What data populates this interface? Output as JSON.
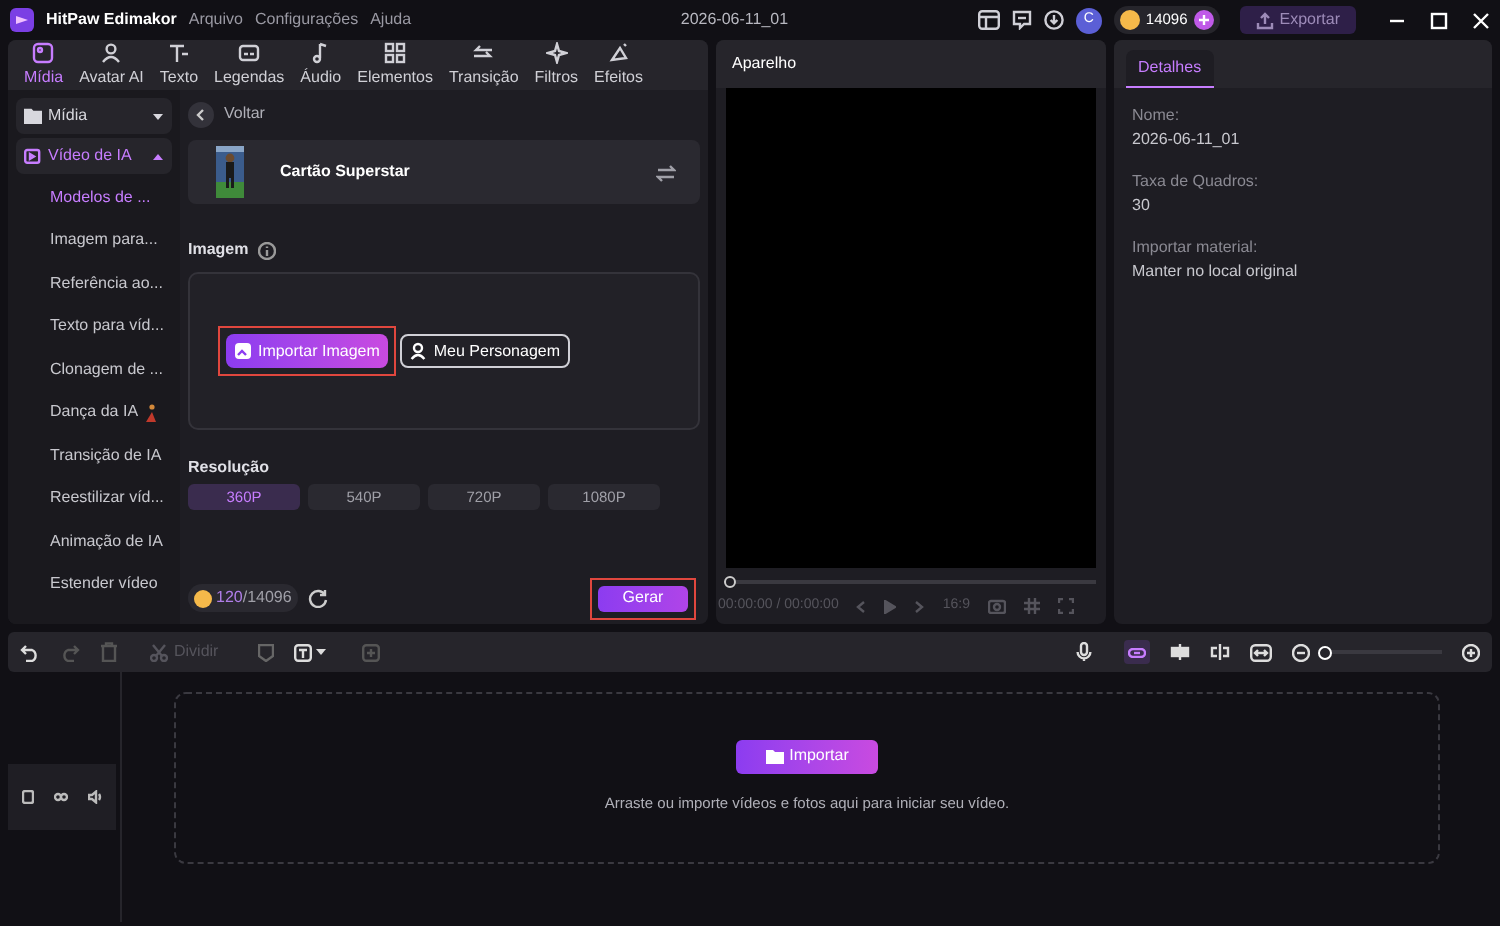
{
  "titlebar": {
    "app_name": "HitPaw Edimakor",
    "menu": [
      "Arquivo",
      "Configurações",
      "Ajuda"
    ],
    "project_title": "2026-06-11_01",
    "avatar_letter": "C",
    "credits": "14096",
    "export": "Exportar"
  },
  "toolbar_tabs": [
    {
      "label": "Mídia",
      "selected": true
    },
    {
      "label": "Avatar AI",
      "selected": false
    },
    {
      "label": "Texto",
      "selected": false
    },
    {
      "label": "Legendas",
      "selected": false
    },
    {
      "label": "Áudio",
      "selected": false
    },
    {
      "label": "Elementos",
      "selected": false
    },
    {
      "label": "Transição",
      "selected": false
    },
    {
      "label": "Filtros",
      "selected": false
    },
    {
      "label": "Efeitos",
      "selected": false
    }
  ],
  "sidebar": [
    {
      "label": "Mídia",
      "expanded": false
    },
    {
      "label": "Vídeo de IA",
      "expanded": true,
      "children": [
        {
          "label": "Modelos de ...",
          "selected": true
        },
        {
          "label": "Imagem para...",
          "selected": false
        },
        {
          "label": "Referência ao...",
          "selected": false
        },
        {
          "label": "Texto para víd...",
          "selected": false
        },
        {
          "label": "Clonagem de ...",
          "selected": false
        },
        {
          "label": "Dança da IA",
          "selected": false,
          "kind": "dance"
        },
        {
          "label": "Transição de IA",
          "selected": false
        },
        {
          "label": "Reestilizar víd...",
          "selected": false
        },
        {
          "label": "Animação de IA",
          "selected": false
        },
        {
          "label": "Estender vídeo",
          "selected": false
        }
      ]
    }
  ],
  "content": {
    "back": "Voltar",
    "template": "Cartão Superstar",
    "image_label": "Imagem",
    "buttons": [
      "Importar Imagem",
      "Meu Personagem"
    ],
    "resolution_label": "Resolução",
    "resolutions": [
      {
        "label": "360P",
        "selected": true
      },
      {
        "label": "540P",
        "selected": false
      },
      {
        "label": "720P",
        "selected": false
      },
      {
        "label": "1080P",
        "selected": false
      }
    ],
    "credits_used": "120",
    "credits_total": "/14096",
    "generate": "Gerar"
  },
  "preview": {
    "title": "Aparelho",
    "level": 0,
    "time": "00:00:00 / 00:00:00",
    "ratio": "16:9"
  },
  "details": {
    "tab": "Detalhes",
    "fields": [
      {
        "label": "Nome:",
        "value": "2026-06-11_01"
      },
      {
        "label": "Taxa de Quadros:",
        "value": "30"
      },
      {
        "label": "Importar material:",
        "value": "Manter no local original"
      }
    ]
  },
  "timeline_toolbar": {
    "split": "Dividir",
    "zoom": {
      "level": 0
    }
  },
  "timeline": {
    "import": "Importar",
    "hint": "Arraste ou importe vídeos e fotos aqui para iniciar seu vídeo."
  }
}
